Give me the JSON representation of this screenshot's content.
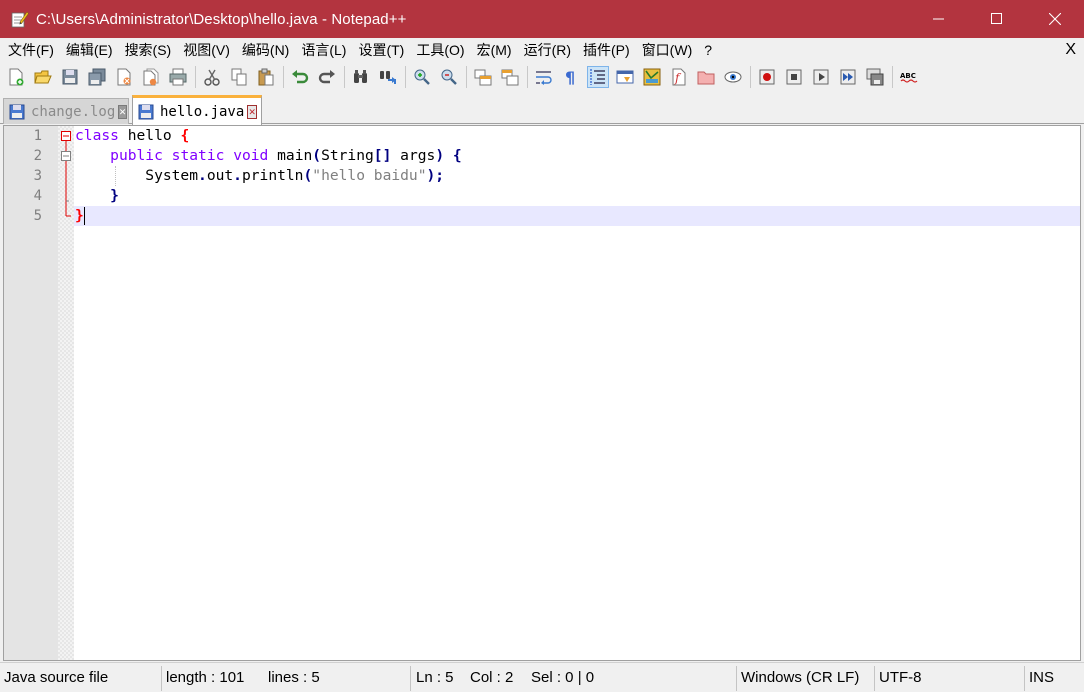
{
  "window": {
    "title": "C:\\Users\\Administrator\\Desktop\\hello.java - Notepad++",
    "accent_color": "#b3343f"
  },
  "menu": {
    "items": [
      "文件(F)",
      "编辑(E)",
      "搜索(S)",
      "视图(V)",
      "编码(N)",
      "语言(L)",
      "设置(T)",
      "工具(O)",
      "宏(M)",
      "运行(R)",
      "插件(P)",
      "窗口(W)",
      "?"
    ],
    "close": "X"
  },
  "toolbar": {
    "icons": [
      "new-file-icon",
      "open-file-icon",
      "save-icon",
      "save-all-icon",
      "close-icon",
      "close-all-icon",
      "print-icon",
      "cut-icon",
      "copy-icon",
      "paste-icon",
      "undo-icon",
      "redo-icon",
      "find-icon",
      "replace-icon",
      "zoom-in-icon",
      "zoom-out-icon",
      "sync-vertical-icon",
      "sync-horizontal-icon",
      "word-wrap-icon",
      "show-all-chars-icon",
      "indent-guide-icon",
      "user-language-icon",
      "document-map-icon",
      "function-list-icon",
      "folder-workspace-icon",
      "monitoring-icon",
      "record-macro-icon",
      "stop-macro-icon",
      "play-macro-icon",
      "run-macro-multiple-icon",
      "save-macro-icon",
      "spell-check-icon"
    ]
  },
  "tabs": [
    {
      "label": "change.log",
      "active": false
    },
    {
      "label": "hello.java",
      "active": true
    }
  ],
  "editor": {
    "line_numbers": [
      "1",
      "2",
      "3",
      "4",
      "5"
    ],
    "lines": [
      [
        {
          "t": "class",
          "c": "kw"
        },
        {
          "t": " hello ",
          "c": "plain"
        },
        {
          "t": "{",
          "c": "brace-hl"
        }
      ],
      [
        {
          "t": "    ",
          "c": "plain"
        },
        {
          "t": "public",
          "c": "kw"
        },
        {
          "t": " ",
          "c": "plain"
        },
        {
          "t": "static",
          "c": "kw"
        },
        {
          "t": " ",
          "c": "plain"
        },
        {
          "t": "void",
          "c": "kw"
        },
        {
          "t": " main",
          "c": "plain"
        },
        {
          "t": "(",
          "c": "op"
        },
        {
          "t": "String",
          "c": "plain"
        },
        {
          "t": "[]",
          "c": "op"
        },
        {
          "t": " args",
          "c": "plain"
        },
        {
          "t": ")",
          "c": "op"
        },
        {
          "t": " ",
          "c": "plain"
        },
        {
          "t": "{",
          "c": "op"
        }
      ],
      [
        {
          "t": "        System",
          "c": "plain"
        },
        {
          "t": ".",
          "c": "op"
        },
        {
          "t": "out",
          "c": "plain"
        },
        {
          "t": ".",
          "c": "op"
        },
        {
          "t": "println",
          "c": "plain"
        },
        {
          "t": "(",
          "c": "op"
        },
        {
          "t": "\"hello baidu\"",
          "c": "str"
        },
        {
          "t": ");",
          "c": "op"
        }
      ],
      [
        {
          "t": "    ",
          "c": "plain"
        },
        {
          "t": "}",
          "c": "op"
        }
      ],
      [
        {
          "t": "}",
          "c": "brace-hl"
        }
      ]
    ],
    "current_line": 5
  },
  "status": {
    "file_type": "Java source file",
    "length": "length : 101",
    "lines": "lines : 5",
    "ln": "Ln : 5",
    "col": "Col : 2",
    "sel": "Sel : 0 | 0",
    "eol": "Windows (CR LF)",
    "encoding": "UTF-8",
    "mode": "INS"
  }
}
